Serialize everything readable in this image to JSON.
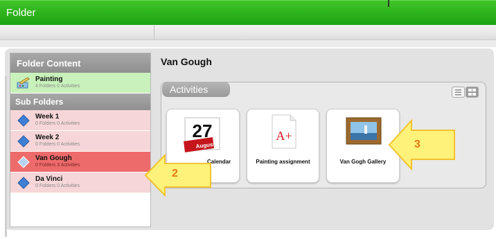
{
  "window": {
    "title": "Folder"
  },
  "sidebar": {
    "header": "Folder Content",
    "root_item": {
      "name": "Painting",
      "meta": "4 Folders 0 Activities"
    },
    "subfolders_header": "Sub Folders",
    "items": [
      {
        "name": "Week 1",
        "meta": "0 Folders 0 Activities"
      },
      {
        "name": "Week 2",
        "meta": "0 Folders 0 Activities"
      },
      {
        "name": "Van Gough",
        "meta": "0 Folders 3 Activities"
      },
      {
        "name": "Da Vinci",
        "meta": "0 Folders 0 Activities"
      }
    ]
  },
  "main": {
    "title": "Van Gough",
    "activities_tab": "Activities",
    "cards": [
      {
        "label": "Calendar",
        "calendar_day": "27",
        "calendar_month": "August"
      },
      {
        "label": "Painting assignment",
        "grade": "A+"
      },
      {
        "label": "Van Gogh Gallery"
      }
    ]
  },
  "callouts": [
    {
      "number": "2"
    },
    {
      "number": "3"
    }
  ],
  "colors": {
    "titlebar": "#22a815",
    "root_item_bg": "#c8f1bb",
    "subfolder_bg": "#f6d6d8",
    "selected_bg": "#ee6b6b",
    "callout_fill": "#fff27a",
    "callout_number": "#e07a10"
  }
}
